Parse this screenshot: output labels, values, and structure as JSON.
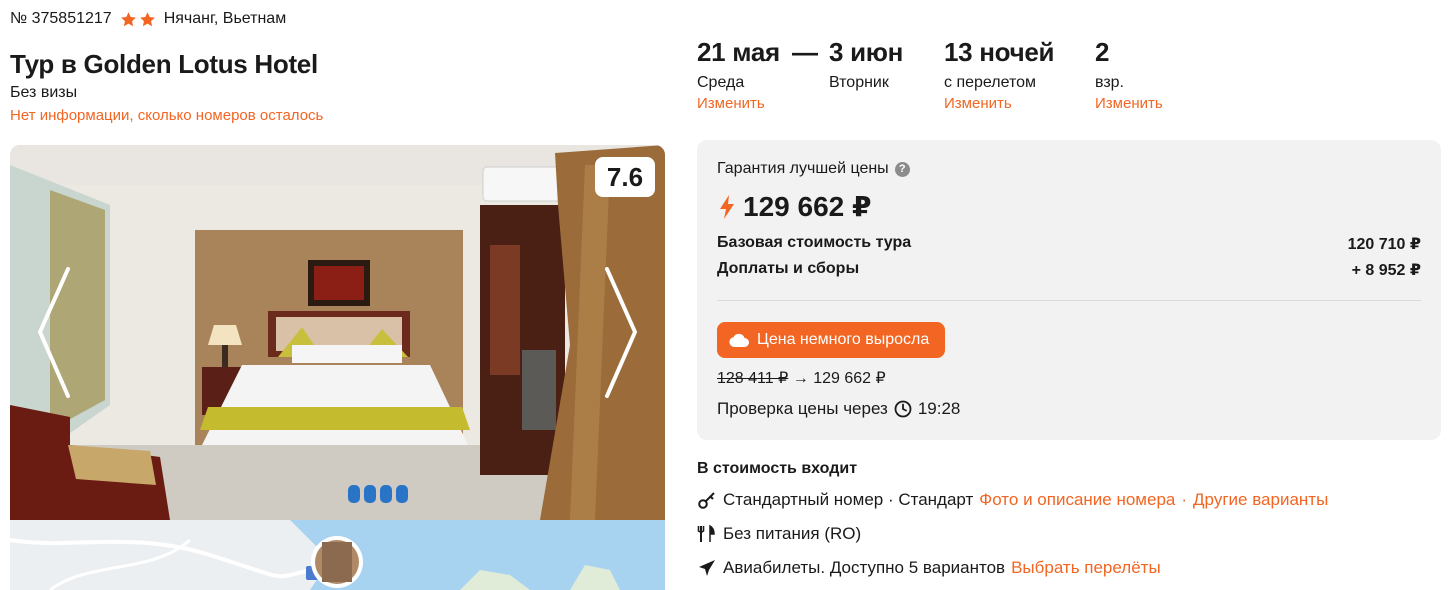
{
  "header": {
    "tour_number": "№ 375851217",
    "location": "Нячанг, Вьетнам",
    "title": "Тур в Golden Lotus Hotel",
    "visa": "Без визы",
    "rooms_info": "Нет информации, сколько номеров осталось",
    "hotel_stars": 2
  },
  "photo": {
    "rating": "7.6"
  },
  "dates": {
    "from_date": "21 мая",
    "from_day": "Среда",
    "change_label": "Изменить",
    "dash": "—",
    "to_date": "3 июн",
    "to_day": "Вторник",
    "nights": "13 ночей",
    "nights_note": "с перелетом",
    "nights_change": "Изменить",
    "guests": "2",
    "guests_note": "взр.",
    "guests_change": "Изменить"
  },
  "price": {
    "guarantee": "Гарантия лучшей цены",
    "total": "129 662 ₽",
    "base_label": "Базовая стоимость тура",
    "base_value": "120 710 ₽",
    "fees_label": "Доплаты и сборы",
    "fees_value": "+ 8 952 ₽",
    "alert": "Цена немного выросла",
    "old_price": "128 411 ₽",
    "arrow": "→",
    "new_price": "129 662 ₽",
    "check_label": "Проверка цены через",
    "check_time": "19:28"
  },
  "included": {
    "title": "В стоимость входит",
    "room": "Стандартный номер · Стандарт",
    "room_link": "Фото и описание номера",
    "sep": "·",
    "room_alt_link": "Другие варианты",
    "meal": "Без питания (RO)",
    "flights": "Авиабилеты. Доступно 5 вариантов",
    "flights_link": "Выбрать перелёты"
  },
  "colors": {
    "accent": "#f26522",
    "card_bg": "#f2f2f2"
  }
}
